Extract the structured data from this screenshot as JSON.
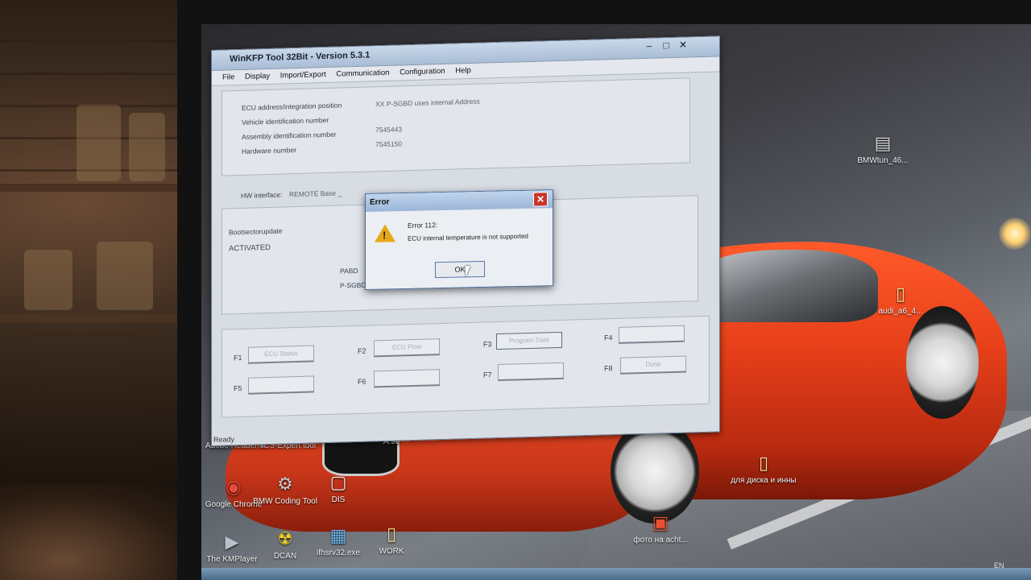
{
  "app": {
    "title": "WinKFP Tool 32Bit - Version 5.3.1",
    "controls": {
      "minimize": "–",
      "maximize": "□",
      "close": "✕"
    },
    "menu": [
      "File",
      "Display",
      "Import/Export",
      "Communication",
      "Configuration",
      "Help"
    ],
    "ecu_info": {
      "fields": [
        {
          "label": "ECU address/integration position",
          "value": "XX   P-SGBD uses internal Address"
        },
        {
          "label": "Vehicle identification number",
          "value": ""
        },
        {
          "label": "Assembly identification number",
          "value": "7545443"
        },
        {
          "label": "Hardware number",
          "value": "7545150"
        }
      ],
      "hw_interface_label": "HW interface:",
      "hw_interface_value": "REMOTE Base _"
    },
    "boot": {
      "label": "Bootsectorupdate",
      "status": "ACTIVATED",
      "pabd_label": "PABD",
      "psgbd_label": "P-SGBD"
    },
    "function_keys": [
      {
        "key": "F1",
        "label": "ECU Status"
      },
      {
        "key": "F2",
        "label": "ECU Flow"
      },
      {
        "key": "F3",
        "label": "Program Data"
      },
      {
        "key": "F4",
        "label": ""
      },
      {
        "key": "F5",
        "label": ""
      },
      {
        "key": "F6",
        "label": ""
      },
      {
        "key": "F7",
        "label": ""
      },
      {
        "key": "F8",
        "label": "Done"
      }
    ],
    "status": "Ready"
  },
  "dialog": {
    "title": "Error",
    "close": "✕",
    "icon": "warning-icon",
    "line1": "Error 112:",
    "line2": "ECU internal temperature is not supported",
    "ok": "OK"
  },
  "desktop_icons": [
    {
      "name": "Adobe Reader X",
      "glyph": "▤"
    },
    {
      "name": "NCS-Expert tool",
      "glyph": "▣"
    },
    {
      "name": "A.90",
      "glyph": ""
    },
    {
      "name": "Google Chrome",
      "glyph": "◉"
    },
    {
      "name": "BMW Coding Tool",
      "glyph": "⚙"
    },
    {
      "name": "DIS",
      "glyph": "▢"
    },
    {
      "name": "The KMPlayer",
      "glyph": "▶"
    },
    {
      "name": "DCAN",
      "glyph": "☢"
    },
    {
      "name": "ifhsrv32.exe",
      "glyph": "▦"
    },
    {
      "name": "WORK",
      "glyph": "▯"
    },
    {
      "name": "BMWtun_46...",
      "glyph": "▤"
    },
    {
      "name": "audi_a6_4...",
      "glyph": "▯"
    },
    {
      "name": "для диска и инны",
      "glyph": "▯"
    },
    {
      "name": "фото на acht...",
      "glyph": "▣"
    }
  ],
  "taskbar": {
    "lang": "EN"
  },
  "colors": {
    "dialog_close": "#c8342a",
    "warning": "#e8a818",
    "car": "#e8401a"
  }
}
